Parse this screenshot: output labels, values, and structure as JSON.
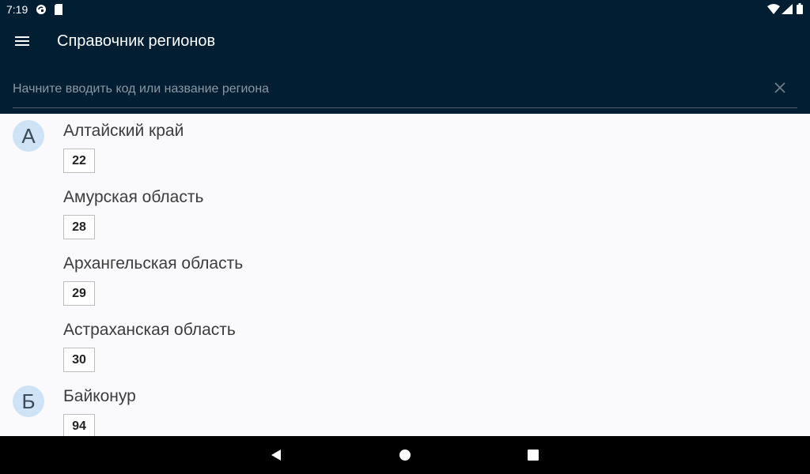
{
  "status_bar": {
    "time": "7:19",
    "icons": [
      "sync-icon",
      "sim-card-icon",
      "wifi-icon",
      "signal-icon",
      "battery-icon"
    ]
  },
  "app_bar": {
    "title": "Справочник регионов",
    "menu_icon": "hamburger-menu-icon"
  },
  "search": {
    "placeholder": "Начните вводить код или название региона",
    "value": "",
    "clear_icon": "close-icon"
  },
  "regions": [
    {
      "letter": "А",
      "name": "Алтайский край",
      "code": "22"
    },
    {
      "name": "Амурская область",
      "code": "28"
    },
    {
      "name": "Архангельская область",
      "code": "29"
    },
    {
      "name": "Астраханская область",
      "code": "30"
    },
    {
      "letter": "Б",
      "name": "Байконур",
      "code": "94"
    }
  ],
  "nav_bar": {
    "icons": [
      "back-icon",
      "home-icon",
      "recents-icon"
    ]
  },
  "colors": {
    "app_bar": "#011e33",
    "letter_bubble": "#cfe3f6",
    "list_background": "#fafafc"
  }
}
